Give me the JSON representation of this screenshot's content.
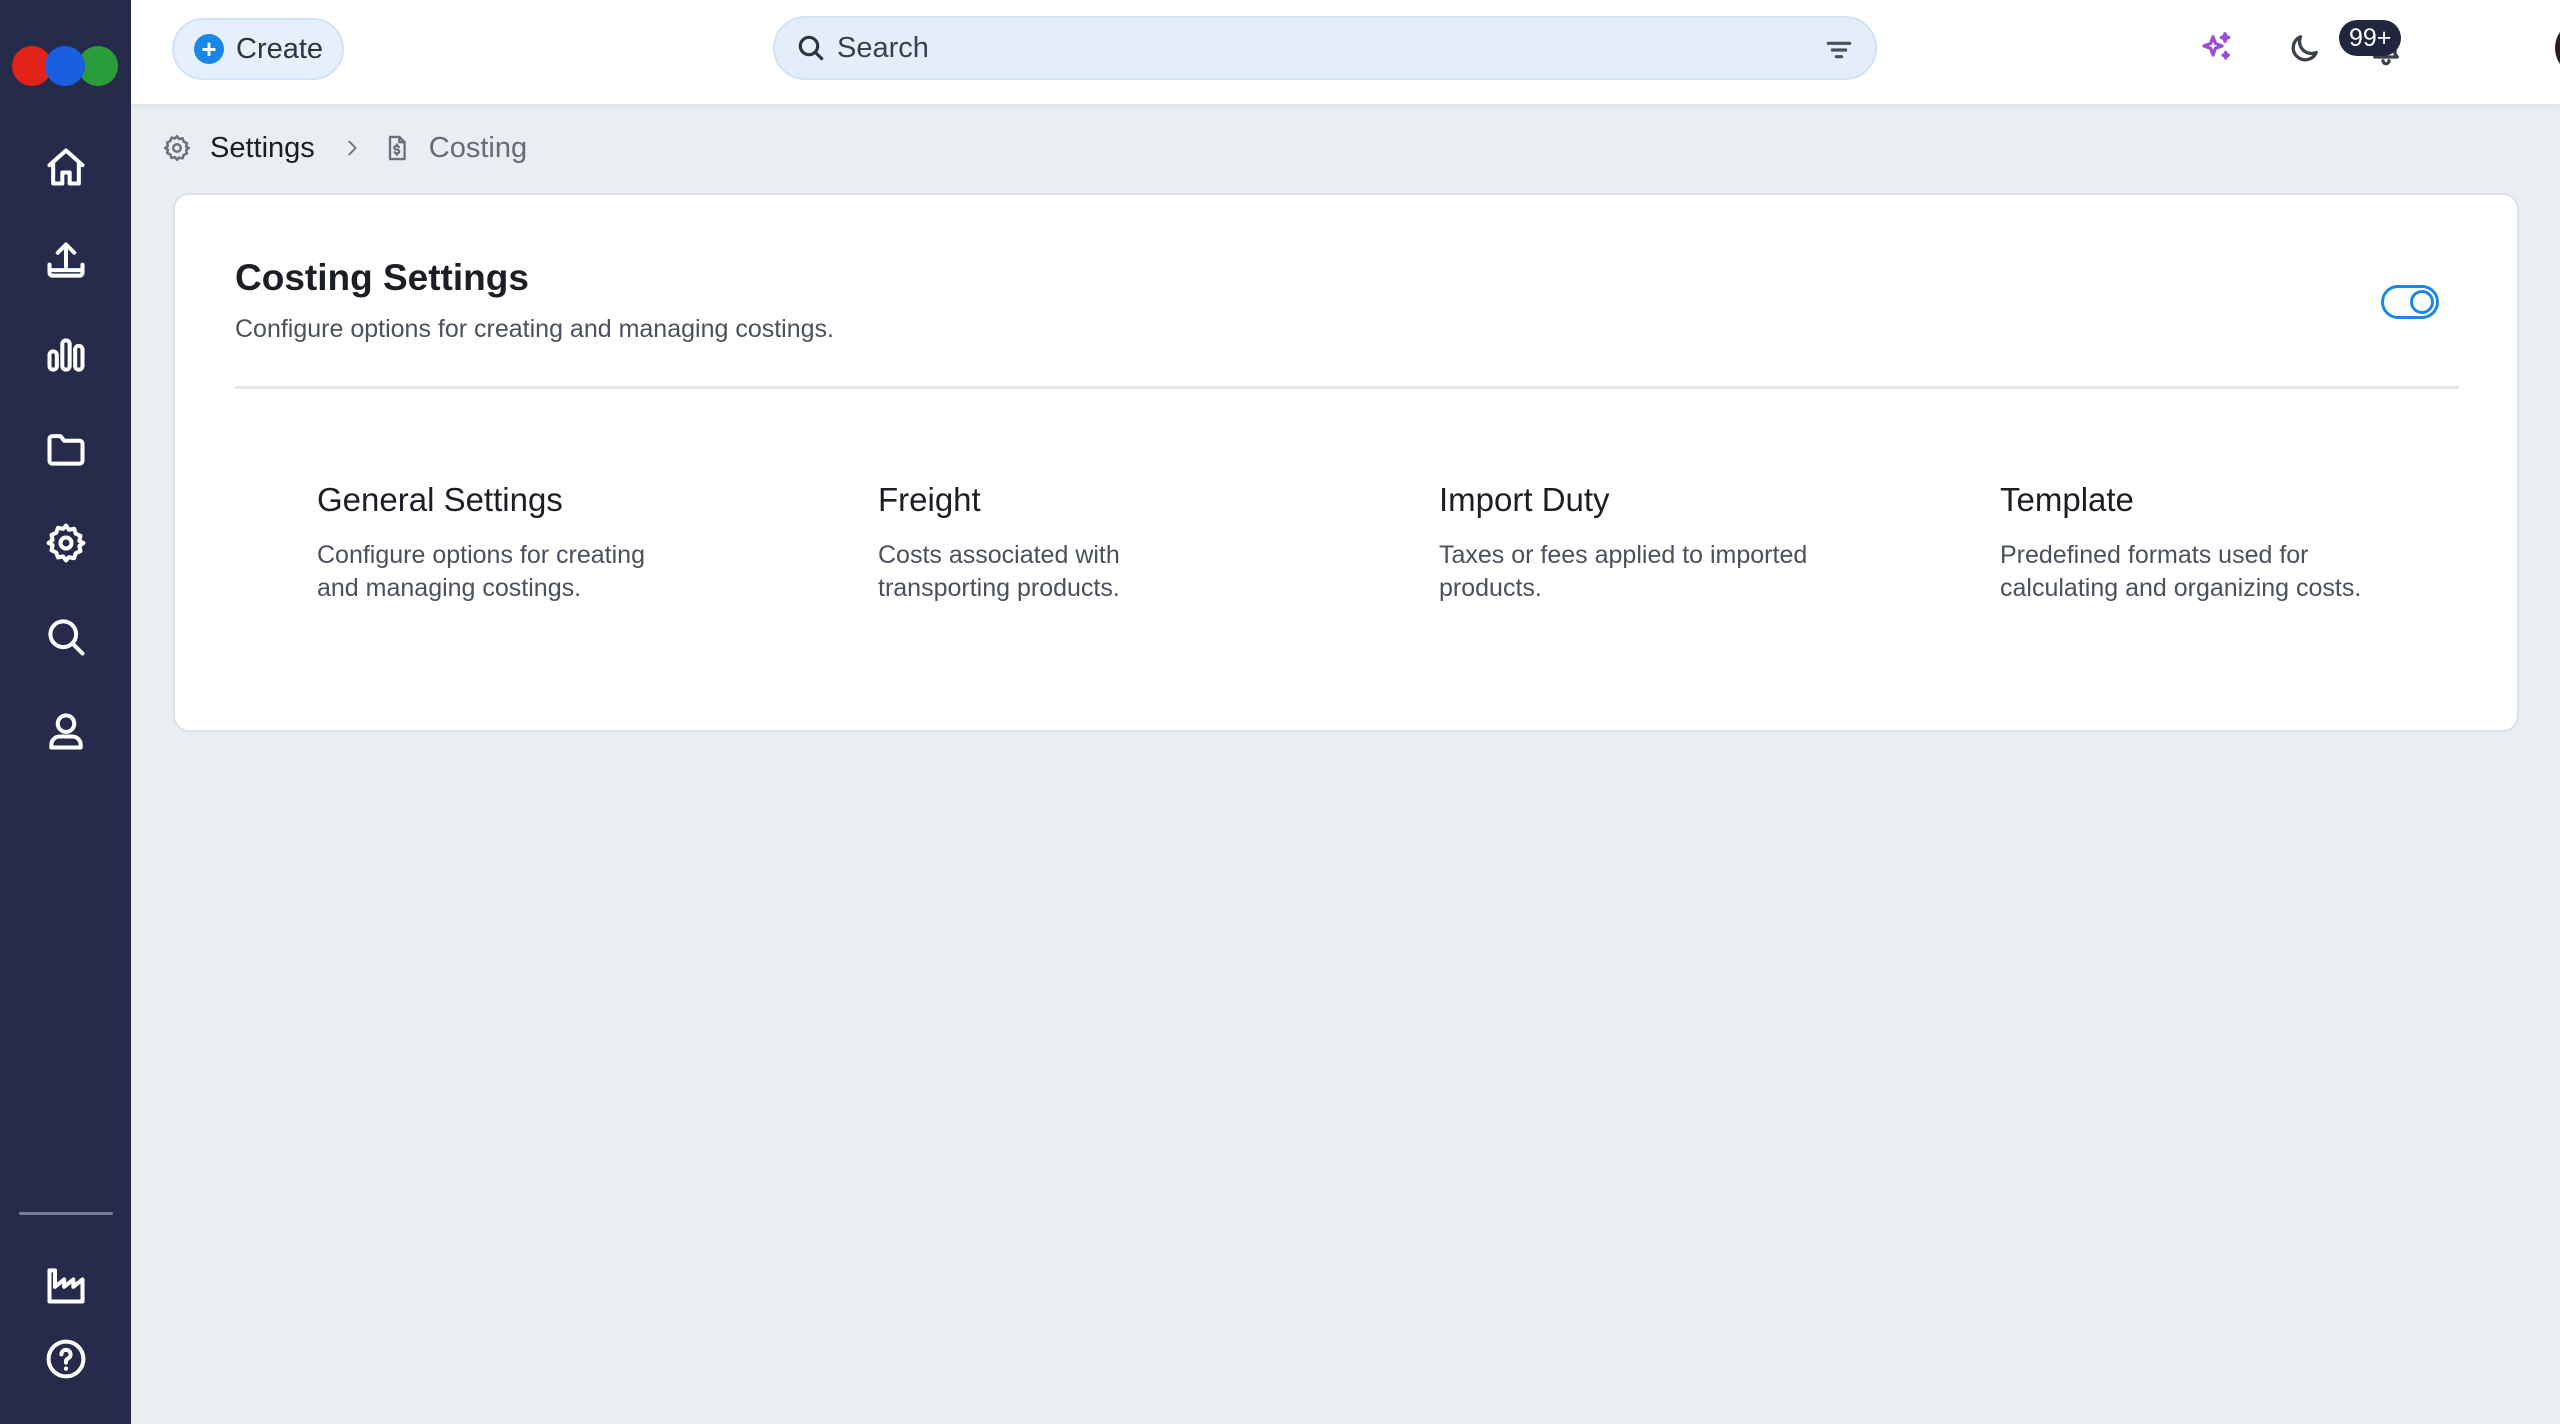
{
  "app": {
    "brand_colors": {
      "red": "#e2231a",
      "blue": "#1b5fe0",
      "green": "#2a9d3a"
    },
    "sidebar_bg": "#262b4b",
    "accent": "#1a87e6"
  },
  "sidebar": {
    "items": [
      {
        "icon": "home-icon"
      },
      {
        "icon": "upload-icon"
      },
      {
        "icon": "bar-chart-icon"
      },
      {
        "icon": "folder-icon"
      },
      {
        "icon": "gear-icon"
      },
      {
        "icon": "search-icon"
      },
      {
        "icon": "user-icon"
      }
    ],
    "bottom_items": [
      {
        "icon": "factory-icon"
      },
      {
        "icon": "help-icon"
      }
    ]
  },
  "topbar": {
    "create_label": "Create",
    "search_placeholder": "Search",
    "notification_count": "99+"
  },
  "breadcrumb": {
    "root": "Settings",
    "current": "Costing"
  },
  "card": {
    "title": "Costing Settings",
    "subtitle": "Configure options for creating and managing costings.",
    "toggle_on": true,
    "tiles": [
      {
        "title": "General Settings",
        "description": "Configure options for creating and managing costings."
      },
      {
        "title": "Freight",
        "description": "Costs associated with transporting products."
      },
      {
        "title": "Import Duty",
        "description": "Taxes or fees applied to imported products."
      },
      {
        "title": "Template",
        "description": "Predefined formats used for calculating and organizing costs."
      }
    ]
  }
}
